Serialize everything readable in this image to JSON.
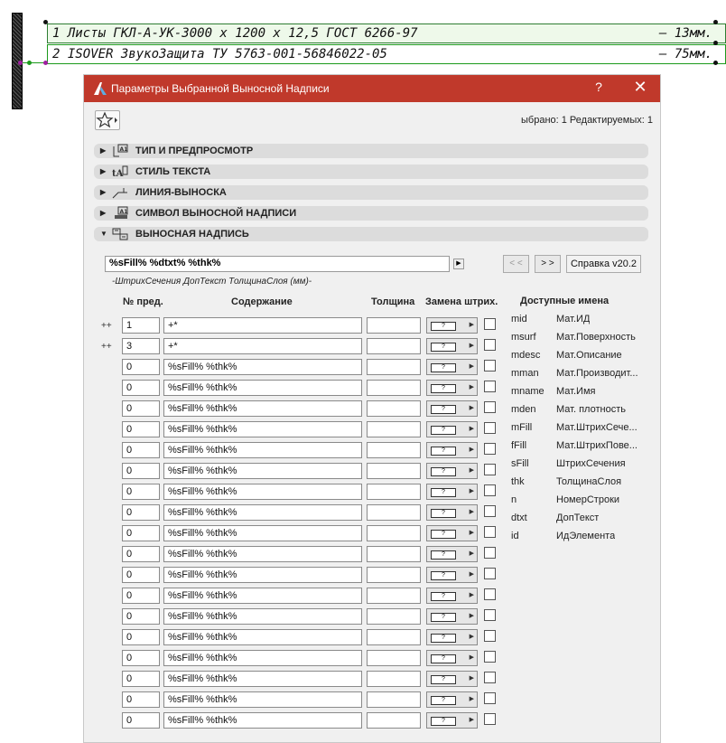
{
  "drawing": {
    "line1": "1 Листы ГКЛ-А-УК-3000 x 1200 x 12,5 ГОСТ 6266-97",
    "line1_value": "– 13мм.",
    "line2": "2 ISOVER ЗвукоЗащита ТУ 5763-001-56846022-05",
    "line2_value": "– 75мм."
  },
  "dialog": {
    "title": "Параметры Выбранной Выносной Надписи",
    "help_label": "?",
    "close_label": "✕",
    "selection_info": "ыбрано: 1 Редактируемых: 1",
    "sections": [
      {
        "label": "ТИП И ПРЕДПРОСМОТР",
        "expanded": false,
        "icon": "label-type-icon"
      },
      {
        "label": "СТИЛЬ ТЕКСТА",
        "expanded": false,
        "icon": "text-style-icon"
      },
      {
        "label": "ЛИНИЯ-ВЫНОСКА",
        "expanded": false,
        "icon": "leader-line-icon"
      },
      {
        "label": "СИМВОЛ ВЫНОСНОЙ НАДПИСИ",
        "expanded": false,
        "icon": "label-symbol-icon"
      },
      {
        "label": "ВЫНОСНАЯ НАДПИСЬ",
        "expanded": true,
        "icon": "callout-icon"
      }
    ],
    "format_string": "%sFill% %dtxt% %thk%",
    "format_description": "-ШтрихСечения ДопТекст ТолщинаСлоя (мм)-",
    "prev_label": "< <",
    "next_label": "> >",
    "help_button_label": "Справка v20.2",
    "columns": {
      "num": "№ пред.",
      "content": "Содержание",
      "thickness": "Толщина",
      "hatch": "Замена штрих."
    },
    "hatch_placeholder": "?",
    "rows": [
      {
        "plus": "++",
        "num": "1",
        "content": "+*",
        "thickness": ""
      },
      {
        "plus": "++",
        "num": "3",
        "content": "+*",
        "thickness": ""
      },
      {
        "plus": "",
        "num": "0",
        "content": "%sFill% %thk%",
        "thickness": ""
      },
      {
        "plus": "",
        "num": "0",
        "content": "%sFill% %thk%",
        "thickness": ""
      },
      {
        "plus": "",
        "num": "0",
        "content": "%sFill% %thk%",
        "thickness": ""
      },
      {
        "plus": "",
        "num": "0",
        "content": "%sFill% %thk%",
        "thickness": ""
      },
      {
        "plus": "",
        "num": "0",
        "content": "%sFill% %thk%",
        "thickness": ""
      },
      {
        "plus": "",
        "num": "0",
        "content": "%sFill% %thk%",
        "thickness": ""
      },
      {
        "plus": "",
        "num": "0",
        "content": "%sFill% %thk%",
        "thickness": ""
      },
      {
        "plus": "",
        "num": "0",
        "content": "%sFill% %thk%",
        "thickness": ""
      },
      {
        "plus": "",
        "num": "0",
        "content": "%sFill% %thk%",
        "thickness": ""
      },
      {
        "plus": "",
        "num": "0",
        "content": "%sFill% %thk%",
        "thickness": ""
      },
      {
        "plus": "",
        "num": "0",
        "content": "%sFill% %thk%",
        "thickness": ""
      },
      {
        "plus": "",
        "num": "0",
        "content": "%sFill% %thk%",
        "thickness": ""
      },
      {
        "plus": "",
        "num": "0",
        "content": "%sFill% %thk%",
        "thickness": ""
      },
      {
        "plus": "",
        "num": "0",
        "content": "%sFill% %thk%",
        "thickness": ""
      },
      {
        "plus": "",
        "num": "0",
        "content": "%sFill% %thk%",
        "thickness": ""
      },
      {
        "plus": "",
        "num": "0",
        "content": "%sFill% %thk%",
        "thickness": ""
      },
      {
        "plus": "",
        "num": "0",
        "content": "%sFill% %thk%",
        "thickness": ""
      },
      {
        "plus": "",
        "num": "0",
        "content": "%sFill% %thk%",
        "thickness": ""
      }
    ],
    "available_names_title": "Доступные имена",
    "available_names": [
      {
        "key": "mid",
        "value": "Мат.ИД"
      },
      {
        "key": "msurf",
        "value": "Мат.Поверхность"
      },
      {
        "key": "mdesc",
        "value": "Мат.Описание"
      },
      {
        "key": "mman",
        "value": "Мат.Производит..."
      },
      {
        "key": "mname",
        "value": "Мат.Имя"
      },
      {
        "key": "mden",
        "value": "Мат. плотность"
      },
      {
        "key": "mFill",
        "value": "Мат.ШтрихСече..."
      },
      {
        "key": "fFill",
        "value": "Мат.ШтрихПове..."
      },
      {
        "key": "sFill",
        "value": "ШтрихСечения"
      },
      {
        "key": "thk",
        "value": "ТолщинаСлоя"
      },
      {
        "key": "n",
        "value": "НомерСтроки"
      },
      {
        "key": "dtxt",
        "value": "ДопТекст"
      },
      {
        "key": "id",
        "value": "ИдЭлемента"
      }
    ]
  },
  "colors": {
    "titlebar": "#c0392b",
    "label_border": "#1c9a1c",
    "label_highlight": "#eef9ea"
  }
}
